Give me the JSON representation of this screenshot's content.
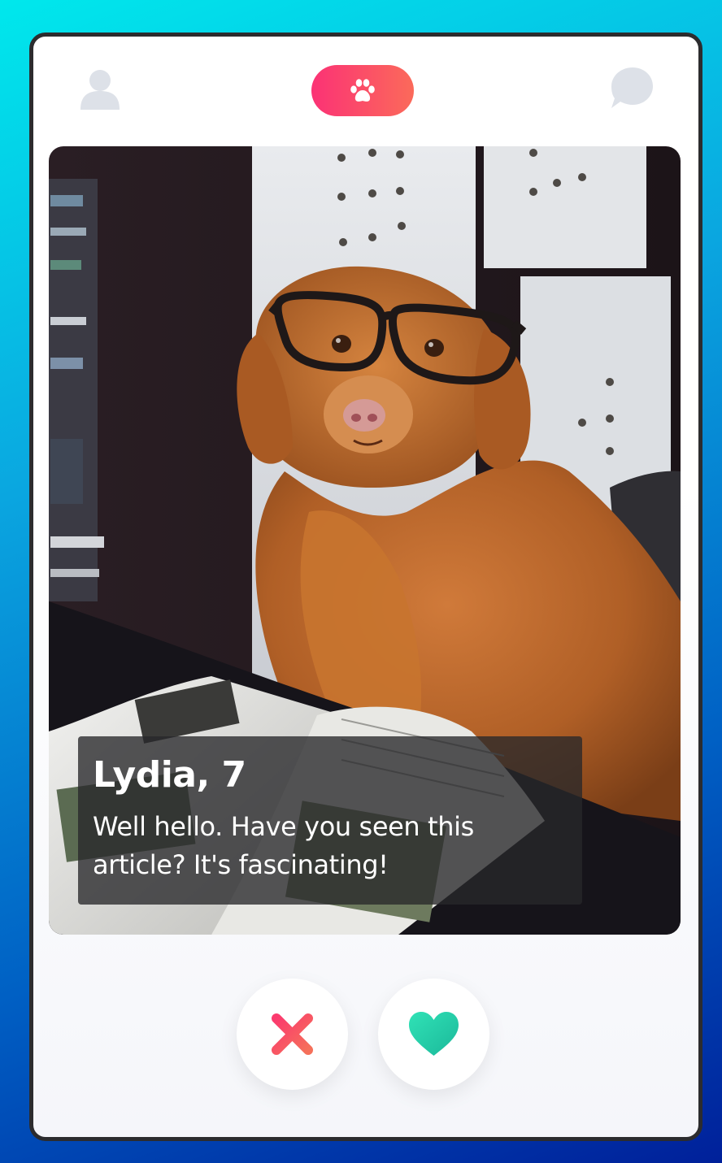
{
  "app": {
    "colors": {
      "brand_gradient_start": "#fb3275",
      "brand_gradient_end": "#fb6a5a",
      "nav_icon_gray": "#dde1e8",
      "nope_start": "#fb3a6e",
      "nope_end": "#f5705a",
      "like_start": "#30e2b6",
      "like_end": "#1bb89a",
      "info_overlay": "#28282a"
    }
  },
  "nav": {
    "profile_icon": "user-icon",
    "logo_icon": "paw-icon",
    "messages_icon": "chat-bubble-icon"
  },
  "card": {
    "photo_description_icon": "dog-photo",
    "name_age": "Lydia, 7",
    "bio": "Well hello. Have you seen this article? It's fascinating!"
  },
  "actions": {
    "nope_icon": "close-icon",
    "like_icon": "heart-icon"
  }
}
